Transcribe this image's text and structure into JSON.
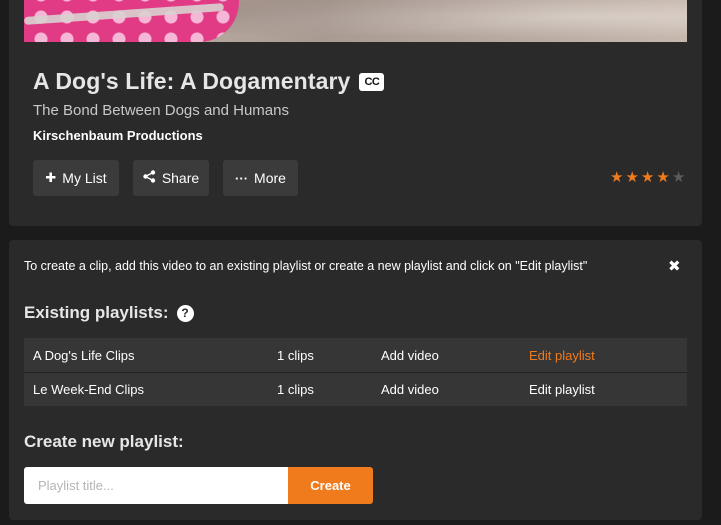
{
  "video": {
    "title": "A Dog's Life: A Dogamentary",
    "cc_badge": "CC",
    "subtitle": "The Bond Between Dogs and Humans",
    "producer": "Kirschenbaum Productions",
    "rating": {
      "value": 4,
      "max": 5,
      "accent_color": "#f07b1d"
    }
  },
  "actions": {
    "my_list": {
      "label": "My List",
      "icon": "plus-icon"
    },
    "share": {
      "label": "Share",
      "icon": "share-icon"
    },
    "more": {
      "label": "More",
      "icon": "ellipsis-icon"
    }
  },
  "clip_panel": {
    "info_text": "To create a clip, add this video to an existing playlist or create a new playlist and click on \"Edit playlist\"",
    "existing_heading": "Existing playlists:",
    "playlists": [
      {
        "name": "A Dog's Life Clips",
        "clips": "1 clips",
        "add_label": "Add video",
        "edit_label": "Edit playlist",
        "edit_highlighted": true
      },
      {
        "name": "Le Week-End Clips",
        "clips": "1 clips",
        "add_label": "Add video",
        "edit_label": "Edit playlist",
        "edit_highlighted": false
      }
    ],
    "create_heading": "Create new playlist:",
    "input": {
      "value": "",
      "placeholder": "Playlist title..."
    },
    "create_label": "Create"
  }
}
